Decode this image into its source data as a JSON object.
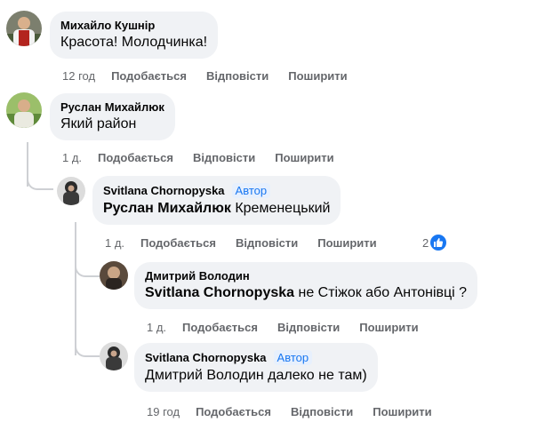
{
  "comments": [
    {
      "author": "Михайло Кушнір",
      "text": "Красота! Молодчинка!",
      "time": "12 год",
      "like": "Подобається",
      "reply": "Відповісти",
      "share": "Поширити"
    },
    {
      "author": "Руслан Михайлюк",
      "text": "Який район",
      "time": "1 д.",
      "like": "Подобається",
      "reply": "Відповісти",
      "share": "Поширити"
    },
    {
      "author": "Svitlana Chornopyska",
      "badge": "Автор",
      "mention": "Руслан Михайлюк",
      "text": " Кременецький",
      "time": "1 д.",
      "like": "Подобається",
      "reply": "Відповісти",
      "share": "Поширити",
      "reaction_count": "2"
    },
    {
      "author": "Дмитрий Володин",
      "mention": "Svitlana Chornopyska",
      "text": " не Стіжок або Антонівці ?",
      "time": "1 д.",
      "like": "Подобається",
      "reply": "Відповісти",
      "share": "Поширити"
    },
    {
      "author": "Svitlana Chornopyska",
      "badge": "Автор",
      "text": "Дмитрий Володин далеко не там)",
      "time": "19 год",
      "like": "Подобається",
      "reply": "Відповісти",
      "share": "Поширити"
    }
  ],
  "colors": {
    "bubble": "#f0f2f5",
    "secondary_text": "#65676b",
    "accent": "#1877f2",
    "thread_line": "#ced0d4"
  },
  "icons": {
    "reaction": "like-thumb-icon"
  }
}
